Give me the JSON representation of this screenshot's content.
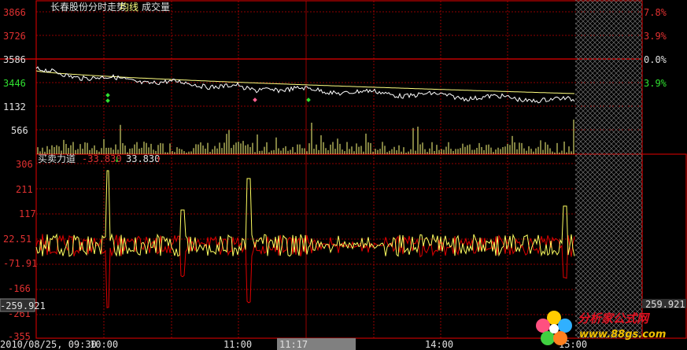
{
  "header": {
    "stock_name": "长春股份分时走势",
    "avg_line_label": "均线",
    "volume_label": "成交量"
  },
  "price_axis_left": [
    "3866",
    "3726",
    "3586",
    "3446",
    "1132",
    "566"
  ],
  "price_axis_right": [
    "7.8%",
    "3.9%",
    "0.0%",
    "3.9%"
  ],
  "indicator": {
    "title": "买卖力道",
    "value_down": "-33.830",
    "value_up": "33.830",
    "arrow_down": "↓",
    "arrow_up": "↑",
    "axis_left": [
      "306",
      "211",
      "117",
      "22.51",
      "-71.91",
      "-166",
      "-261",
      "-355"
    ],
    "cursor_value": "-259.921",
    "right_box_value": "259.921"
  },
  "time_axis": {
    "start_label": "2010/08/25, 09:30",
    "labels": [
      "10:00",
      "11:00",
      "11:17",
      "14:00",
      "15:00"
    ]
  },
  "watermark": {
    "main": "分析家公式网",
    "sub": "www.88gs.com"
  },
  "colors": {
    "background": "#000000",
    "grid": "#c00000",
    "price_line": "#ffffff",
    "avg_line": "#ffff80",
    "volume_bar": "#ffff80",
    "buy_force": "#ffff60",
    "sell_force": "#e00000",
    "axis_text_up": "#e03030",
    "axis_text_down": "#30e030",
    "label_white": "#e0e0e0"
  }
}
